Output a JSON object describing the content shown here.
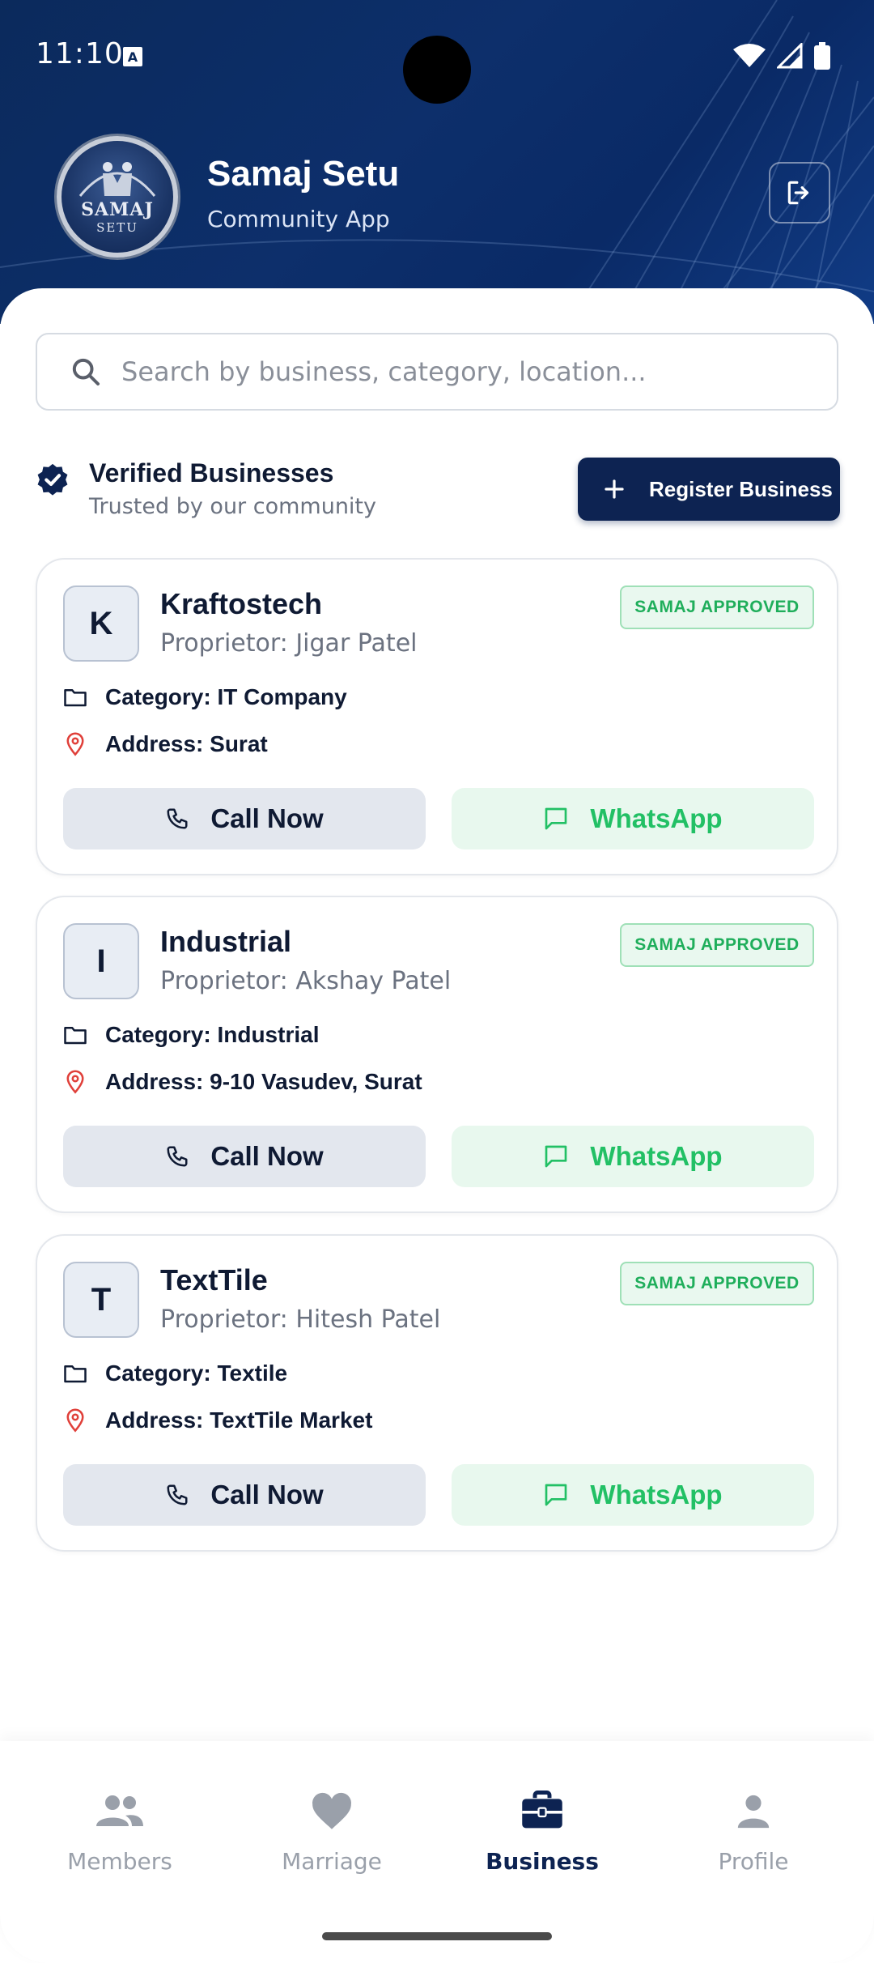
{
  "status_bar": {
    "time": "11:10",
    "notification_badge": "A"
  },
  "header": {
    "logo_text_top": "SAMAJ",
    "logo_text_bottom": "SETU",
    "title": "Samaj Setu",
    "subtitle": "Community App",
    "logout_icon": "logout-icon"
  },
  "search": {
    "placeholder": "Search by business, category, location..."
  },
  "section": {
    "title": "Verified Businesses",
    "subtitle": "Trusted by our community",
    "register_label": "Register Business"
  },
  "businesses": [
    {
      "initial": "K",
      "name": "Kraftostech",
      "owner": "Proprietor: Jigar Patel",
      "badge": "SAMAJ APPROVED",
      "category": "Category: IT Company",
      "address": "Address: Surat",
      "call_label": "Call Now",
      "whatsapp_label": "WhatsApp"
    },
    {
      "initial": "I",
      "name": "Industrial",
      "owner": "Proprietor: Akshay Patel",
      "badge": "SAMAJ APPROVED",
      "category": "Category: Industrial",
      "address": "Address: 9-10 Vasudev, Surat",
      "call_label": "Call Now",
      "whatsapp_label": "WhatsApp"
    },
    {
      "initial": "T",
      "name": "TextTile",
      "owner": "Proprietor: Hitesh Patel",
      "badge": "SAMAJ APPROVED",
      "category": "Category: Textile",
      "address": "Address: TextTile Market",
      "call_label": "Call Now",
      "whatsapp_label": "WhatsApp"
    }
  ],
  "bottom_nav": [
    {
      "label": "Members",
      "icon": "members-icon",
      "active": false
    },
    {
      "label": "Marriage",
      "icon": "heart-icon",
      "active": false
    },
    {
      "label": "Business",
      "icon": "briefcase-icon",
      "active": true
    },
    {
      "label": "Profile",
      "icon": "person-icon",
      "active": false
    }
  ],
  "colors": {
    "primary": "#0d2352",
    "approved_green": "#1fae5b",
    "whatsapp_green": "#22c065",
    "pin_red": "#e0403a"
  }
}
